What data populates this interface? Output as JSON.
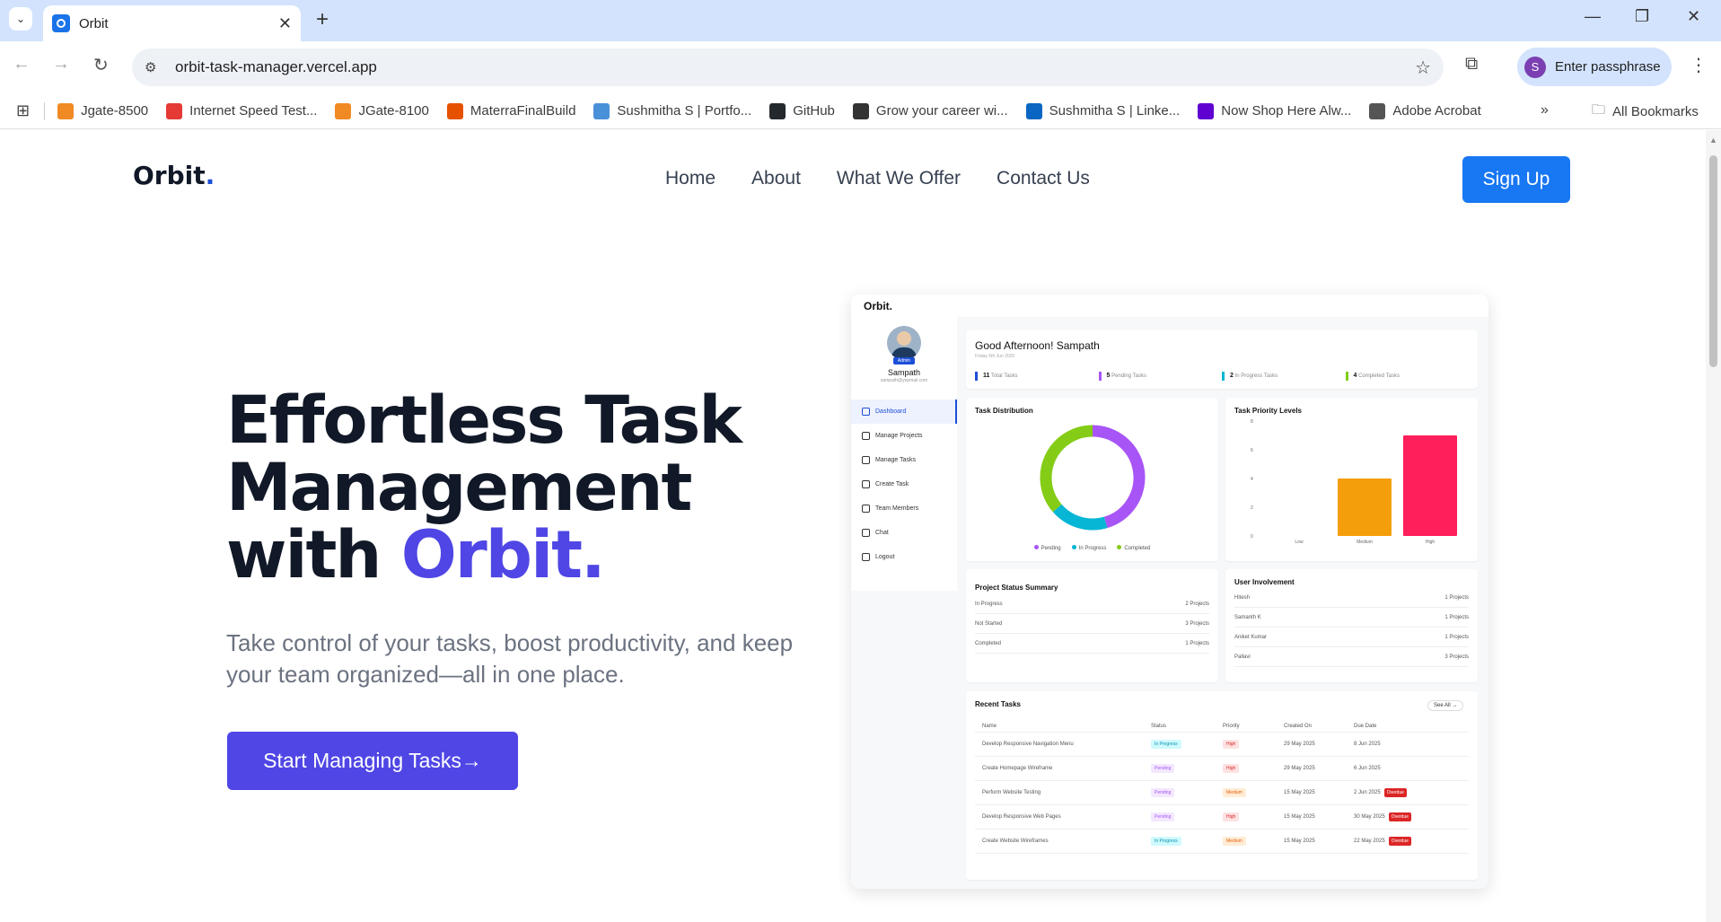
{
  "browser": {
    "tab_title": "Orbit",
    "url": "orbit-task-manager.vercel.app",
    "profile_label": "Enter passphrase",
    "profile_initial": "S",
    "bookmarks": [
      {
        "label": "Jgate-8500",
        "color": "#f08a24"
      },
      {
        "label": "Internet Speed Test...",
        "color": "#e53935"
      },
      {
        "label": "JGate-8100",
        "color": "#f08a24"
      },
      {
        "label": "MaterraFinalBuild",
        "color": "#e65100"
      },
      {
        "label": "Sushmitha S | Portfo...",
        "color": "#4a90d9"
      },
      {
        "label": "GitHub",
        "color": "#24292e"
      },
      {
        "label": "Grow your career wi...",
        "color": "#333333"
      },
      {
        "label": "Sushmitha S | Linke...",
        "color": "#0a66c2"
      },
      {
        "label": "Now Shop Here Alw...",
        "color": "#5f01d1"
      },
      {
        "label": "Adobe Acrobat",
        "color": "#555555"
      }
    ],
    "all_bookmarks": "All Bookmarks"
  },
  "site": {
    "logo": "Orbit",
    "logo_dot": ".",
    "nav": [
      "Home",
      "About",
      "What We Offer",
      "Contact Us"
    ],
    "signup": "Sign Up",
    "hero_line1": "Effortless Task",
    "hero_line2": "Management",
    "hero_line3": "with ",
    "hero_brand": "Orbit.",
    "hero_sub": "Take control of your tasks, boost productivity, and keep your team organized—all in one place.",
    "cta": "Start Managing Tasks",
    "cta_arrow": "→",
    "accent": "#4f46e5",
    "signup_color": "#1877f2"
  },
  "preview": {
    "logo": "Orbit.",
    "user_name": "Sampath",
    "user_email": "sampath@yopmail.com",
    "role": "Admin",
    "menu": [
      "Dashboard",
      "Manage Projects",
      "Manage Tasks",
      "Create Task",
      "Team Members",
      "Chat",
      "Logout"
    ],
    "greeting": "Good Afternoon! Sampath",
    "date": "Friday 6th Jun 2025",
    "stats": [
      {
        "value": "11",
        "label": "Total Tasks",
        "color": "#1d4ed8"
      },
      {
        "value": "5",
        "label": "Pending Tasks",
        "color": "#a855f7"
      },
      {
        "value": "2",
        "label": "In Progress Tasks",
        "color": "#06b6d4"
      },
      {
        "value": "4",
        "label": "Completed Tasks",
        "color": "#84cc16"
      }
    ],
    "dist_title": "Task Distribution",
    "dist_legend": [
      "Pending",
      "In Progress",
      "Completed"
    ],
    "prio_title": "Task Priority Levels",
    "proj_title": "Project Status Summary",
    "proj_rows": [
      {
        "k": "In Progress",
        "v": "2 Projects"
      },
      {
        "k": "Not Started",
        "v": "3 Projects"
      },
      {
        "k": "Completed",
        "v": "1 Projects"
      }
    ],
    "inv_title": "User Involvement",
    "inv_rows": [
      {
        "k": "Hitesh",
        "v": "1 Projects"
      },
      {
        "k": "Samanth K",
        "v": "1 Projects"
      },
      {
        "k": "Aniket Kumar",
        "v": "1 Projects"
      },
      {
        "k": "Pallavi",
        "v": "3 Projects"
      }
    ],
    "recent_title": "Recent Tasks",
    "see_all": "See All",
    "cols": [
      "Name",
      "Status",
      "Priority",
      "Created On",
      "Due Date"
    ],
    "tasks": [
      {
        "name": "Develop Responsive Navigation Menu",
        "status": "In Progress",
        "priority": "High",
        "created": "29 May 2025",
        "due": "8 Jun 2025",
        "overdue": ""
      },
      {
        "name": "Create Homepage Wireframe",
        "status": "Pending",
        "priority": "High",
        "created": "29 May 2025",
        "due": "6 Jun 2025",
        "overdue": ""
      },
      {
        "name": "Perform Website Testing",
        "status": "Pending",
        "priority": "Medium",
        "created": "15 May 2025",
        "due": "2 Jun 2025",
        "overdue": "Overdue"
      },
      {
        "name": "Develop Responsive Web Pages",
        "status": "Pending",
        "priority": "High",
        "created": "15 May 2025",
        "due": "30 May 2025",
        "overdue": "Overdue"
      },
      {
        "name": "Create Website Wireframes",
        "status": "In Progress",
        "priority": "Medium",
        "created": "15 May 2025",
        "due": "22 May 2025",
        "overdue": "Overdue"
      }
    ]
  },
  "chart_data": [
    {
      "type": "pie",
      "title": "Task Distribution",
      "categories": [
        "Pending",
        "In Progress",
        "Completed"
      ],
      "values": [
        5,
        2,
        4
      ],
      "colors": [
        "#a855f7",
        "#06b6d4",
        "#84cc16"
      ]
    },
    {
      "type": "bar",
      "title": "Task Priority Levels",
      "categories": [
        "Low",
        "Medium",
        "High"
      ],
      "values": [
        0,
        4,
        7
      ],
      "colors": [
        "#cccccc",
        "#f59e0b",
        "#ff1f5a"
      ],
      "ylim": [
        0,
        8
      ],
      "yticks": [
        0,
        2,
        4,
        6,
        8
      ]
    }
  ]
}
